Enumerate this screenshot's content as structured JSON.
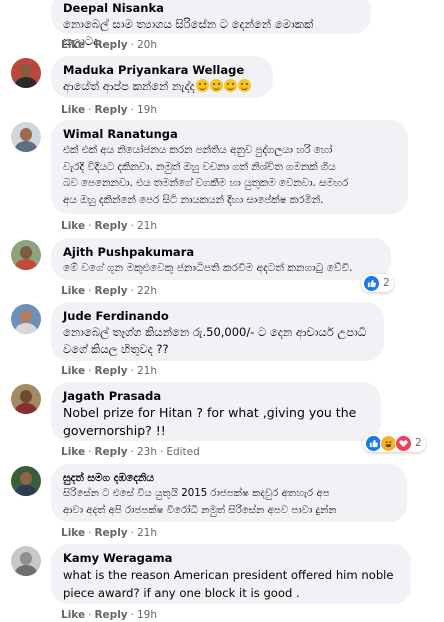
{
  "comments": [
    {
      "author": "Deepal Nisanka",
      "text": "නොබෙල් සාම ත්‍යාගය සිරිසේන ට දෙන්නේ මොකක් කලාටද...",
      "like_label": "Like",
      "reply_label": "Reply",
      "time": "20h",
      "avatar_colors": {
        "bg": "#7b8a6e",
        "face": "#c9a27c",
        "body": "#3c4650"
      }
    },
    {
      "author": "Maduka Priyankara Wellage",
      "text": "ආයේත් ආප්ප කන්නේ නැද්ද",
      "emoji_count": 4,
      "like_label": "Like",
      "reply_label": "Reply",
      "time": "19h",
      "avatar_colors": {
        "bg": "#b9473a",
        "face": "#8a5a3c",
        "body": "#2b2b2b"
      }
    },
    {
      "author": "Wimal Ranatunga",
      "text": "එක් එක් අය නියෝජනය කරන පන්තිය අනුව පුද්ගලයා හරි හෝ\nවැරදි විදියට දකිනවා. නමුත් ඔහු වචනා ගත් නිශ්චිත ගමනක් ගිය\nබව පෙනෙනවා. එය තමන්ගේ වගකීම හා යුතුකම වෙනවා. සමහර\nඅය ඔහු දකින්නේ පෙර සිටි නායකයන් දිහා සාපේක්ෂ කරමින්.",
      "like_label": "Like",
      "reply_label": "Reply",
      "time": "21h",
      "avatar_colors": {
        "bg": "#cfd6dc",
        "face": "#9a6b4f",
        "body": "#5d6f80"
      }
    },
    {
      "author": "Ajith Pushpakumara",
      "text": "මේ වගේ ගුන මකුළුවෙකු ජනාධිපති කරවීම අදටත් කනගාටු වේවී.",
      "like_label": "Like",
      "reply_label": "Reply",
      "time": "22h",
      "reaction_count": "2",
      "reactions": [
        "like"
      ],
      "avatar_colors": {
        "bg": "#8fa37a",
        "face": "#7c5a44",
        "body": "#c04a3b"
      }
    },
    {
      "author": "Jude Ferdinando",
      "text": "නොබෙල් තෑග්ග කියන්නෙ රු.50,000/- ට දෙන ආචාර්ය උපාධි\nවගේ කියල හිතුවද ??",
      "like_label": "Like",
      "reply_label": "Reply",
      "time": "21h",
      "avatar_colors": {
        "bg": "#6d8fb8",
        "face": "#b07f5f",
        "body": "#d8d8d8"
      }
    },
    {
      "author": "Jagath Prasada",
      "text": "Nobel prize for Hitan ? for what ,giving you the\ngovernorship? !!",
      "like_label": "Like",
      "reply_label": "Reply",
      "time": "23h",
      "edited_label": "Edited",
      "reaction_count": "2",
      "reactions": [
        "like",
        "haha",
        "love"
      ],
      "avatar_colors": {
        "bg": "#a08b63",
        "face": "#6e4a33",
        "body": "#8a2f2f"
      }
    },
    {
      "author": "සුදත් සමග දඹදෙනිය",
      "text": "සිරිසේන ට එසේ විය යුතුයි 2015 රාජපක්ෂ කදවුර අතහැර අප\nආවා අදත් අපි රාජපක්ෂ විරෝධී නමුත් සිරිසේන අපව පාවා දුන්න",
      "like_label": "Like",
      "reply_label": "Reply",
      "time": "21h",
      "avatar_colors": {
        "bg": "#3b5e3a",
        "face": "#8c6446",
        "body": "#2d3b55"
      }
    },
    {
      "author": "Kamy Weragama",
      "text": "what is the reason American president offered him noble\npiece award? if any one block it is good .",
      "like_label": "Like",
      "reply_label": "Reply",
      "time": "19h",
      "avatar_colors": {
        "bg": "#c8c8c8",
        "face": "#8f8f8f",
        "body": "#6f6f6f"
      }
    }
  ],
  "reaction_colors": {
    "like": "#1877f2",
    "haha": "#f7b125",
    "love": "#f33e58"
  }
}
